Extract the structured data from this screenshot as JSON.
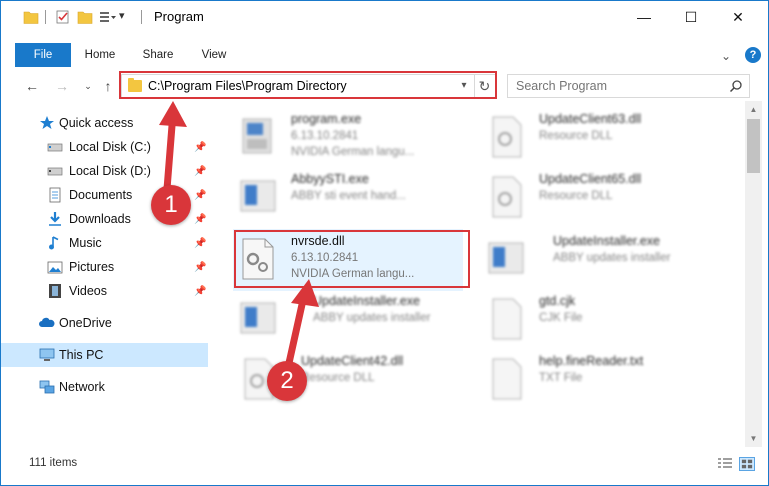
{
  "window": {
    "title": "Program",
    "minimize": "—",
    "maximize": "☐",
    "close": "✕"
  },
  "ribbon": {
    "tabs": [
      {
        "label": "File"
      },
      {
        "label": "Home"
      },
      {
        "label": "Share"
      },
      {
        "label": "View"
      }
    ],
    "expand": "⌄",
    "help": "?"
  },
  "address": {
    "path": "C:\\Program Files\\Program Directory"
  },
  "search": {
    "placeholder": "Search Program"
  },
  "nav": {
    "items": [
      {
        "label": "Quick access",
        "icon": "star-icon"
      },
      {
        "label": "Local Disk (C:)",
        "icon": "drive-icon"
      },
      {
        "label": "Local Disk (D:)",
        "icon": "drive-icon"
      },
      {
        "label": "Documents",
        "icon": "documents-icon"
      },
      {
        "label": "Downloads",
        "icon": "download-icon"
      },
      {
        "label": "Music",
        "icon": "music-icon"
      },
      {
        "label": "Pictures",
        "icon": "pictures-icon"
      },
      {
        "label": "Videos",
        "icon": "videos-icon"
      },
      {
        "label": "OneDrive",
        "icon": "cloud-icon"
      },
      {
        "label": "This PC",
        "icon": "computer-icon"
      },
      {
        "label": "Network",
        "icon": "network-icon"
      }
    ]
  },
  "files": [
    {
      "name": "program.exe",
      "version": "6.13.10.2841",
      "desc": "NVIDIA German langu..."
    },
    {
      "name": "UpdateClient63.dll",
      "version": "",
      "desc": "Resource DLL"
    },
    {
      "name": "AbbyySTI.exe",
      "version": "",
      "desc": "ABBY sti event hand..."
    },
    {
      "name": "UpdateClient65.dll",
      "version": "",
      "desc": "Resource DLL"
    },
    {
      "name": "nvrsde.dll",
      "version": "6.13.10.2841",
      "desc": "NVIDIA German langu..."
    },
    {
      "name": "UpdateInstaller.exe",
      "version": "",
      "desc": "ABBY updates installer"
    },
    {
      "name": "UpdateInstaller.exe",
      "version": "",
      "desc": "ABBY updates installer"
    },
    {
      "name": "gtd.cjk",
      "version": "",
      "desc": "CJK File"
    },
    {
      "name": "UpdateClient42.dll",
      "version": "",
      "desc": "Resource DLL"
    },
    {
      "name": "help.fineReader.txt",
      "version": "",
      "desc": "TXT File"
    }
  ],
  "status": {
    "items": "111 items"
  },
  "annotations": {
    "step1": "1",
    "step2": "2"
  },
  "colors": {
    "accent": "#1979ca",
    "highlight": "#d9363a",
    "selected": "#cce8ff"
  }
}
